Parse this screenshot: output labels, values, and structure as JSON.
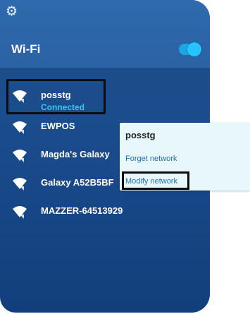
{
  "header": {
    "title": "Wi-Fi",
    "settings_icon": "gear-icon",
    "wifi_toggle_on": true,
    "accent": "#1ba7e6"
  },
  "networks": [
    {
      "name": "posstg",
      "status": "Connected",
      "icon": "wifi-icon"
    },
    {
      "name": "EWPOS",
      "icon": "wifi-icon"
    },
    {
      "name": "Magda's Galaxy",
      "icon": "wifi-icon"
    },
    {
      "name": "Galaxy A52B5BF",
      "icon": "wifi-icon"
    },
    {
      "name": "MAZZER-64513929",
      "icon": "wifi-icon"
    }
  ],
  "popup": {
    "title": "posstg",
    "forget_label": "Forget network",
    "modify_label": "Modify network"
  },
  "colors": {
    "background": "#1a4b8c",
    "connected": "#34c6f5"
  }
}
